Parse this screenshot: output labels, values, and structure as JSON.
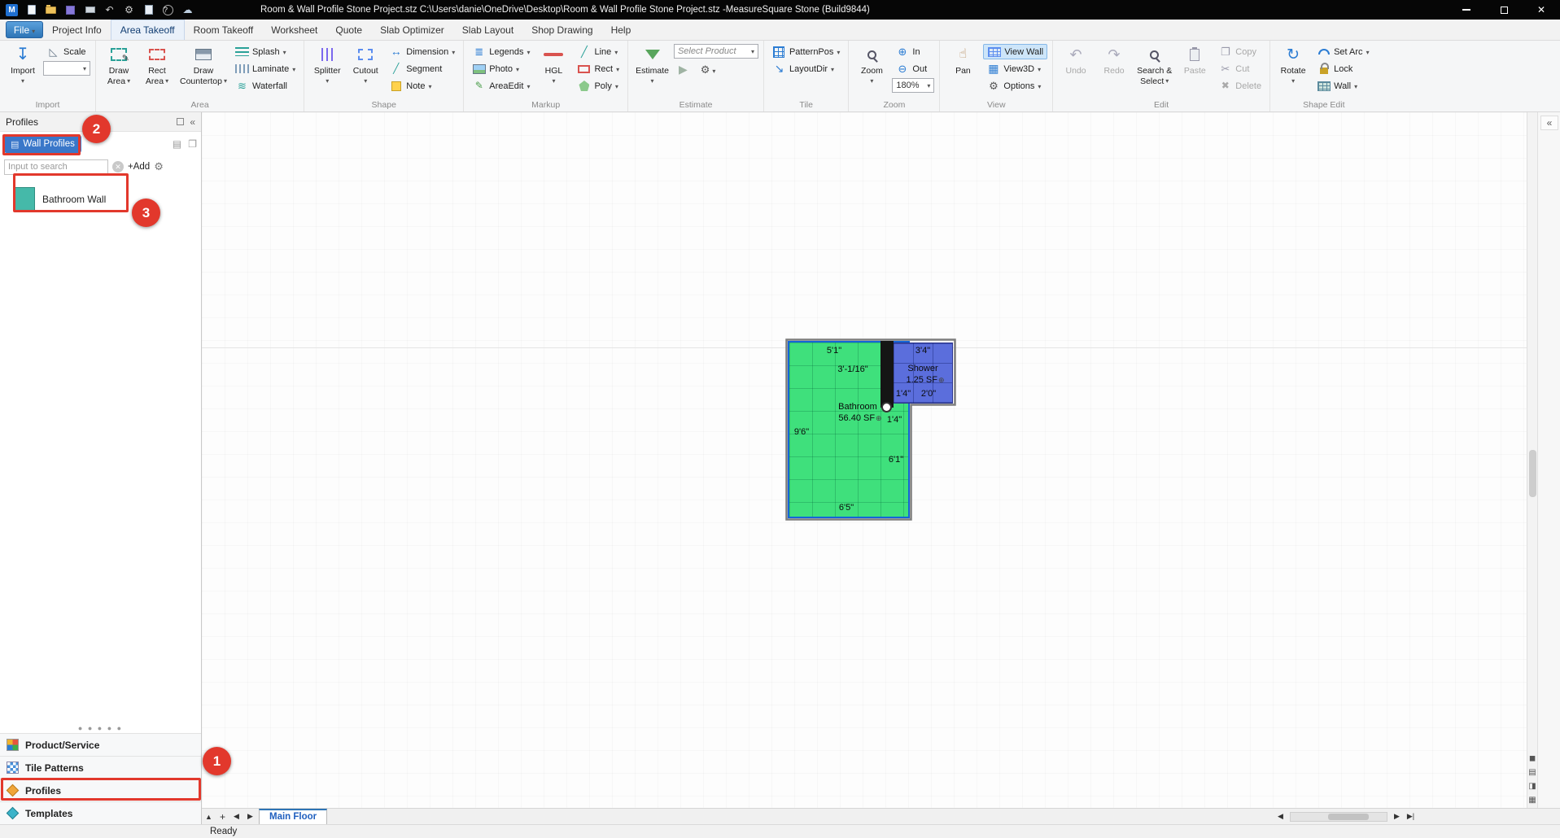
{
  "titlebar": {
    "app_initial": "M",
    "title": "Room & Wall Profile Stone Project.stz C:\\Users\\danie\\OneDrive\\Desktop\\Room & Wall Profile Stone Project.stz -MeasureSquare Stone (Build9844)"
  },
  "menu": {
    "file": "File",
    "tabs": [
      "Project Info",
      "Area Takeoff",
      "Room Takeoff",
      "Worksheet",
      "Quote",
      "Slab Optimizer",
      "Slab Layout",
      "Shop Drawing",
      "Help"
    ],
    "active_tab": "Area Takeoff"
  },
  "ribbon": {
    "groups": {
      "import": "Import",
      "area": "Area",
      "shape": "Shape",
      "markup": "Markup",
      "estimate": "Estimate",
      "tile": "Tile",
      "zoom": "Zoom",
      "view": "View",
      "edit": "Edit",
      "shape_edit": "Shape Edit"
    },
    "import_btn": "Import",
    "scale": "Scale",
    "draw_area": [
      "Draw",
      "Area"
    ],
    "rect_area": [
      "Rect",
      "Area"
    ],
    "draw_countertop": [
      "Draw",
      "Countertop"
    ],
    "splash": "Splash",
    "laminate": "Laminate",
    "waterfall": "Waterfall",
    "splitter": "Splitter",
    "cutout": "Cutout",
    "dimension": "Dimension",
    "segment": "Segment",
    "note": "Note",
    "legends": "Legends",
    "photo": "Photo",
    "areaedit": "AreaEdit",
    "hgl": "HGL",
    "line": "Line",
    "rect": "Rect",
    "poly": "Poly",
    "estimate_btn": "Estimate",
    "select_product": "Select Product",
    "patternpos": "PatternPos",
    "layoutdir": "LayoutDir",
    "zoom_btn": "Zoom",
    "zoom_in": "In",
    "zoom_out": "Out",
    "zoom_level": "180%",
    "pan": "Pan",
    "view_wall": "View Wall",
    "view3d": "View3D",
    "options": "Options",
    "undo": "Undo",
    "redo": "Redo",
    "search_select": [
      "Search &",
      "Select"
    ],
    "paste": "Paste",
    "copy": "Copy",
    "cut": "Cut",
    "delete": "Delete",
    "rotate": "Rotate",
    "set_arc": "Set Arc",
    "lock": "Lock",
    "wall": "Wall"
  },
  "sidebar": {
    "header": "Profiles",
    "profile_selector": "Wall Profiles",
    "search_placeholder": "Input to search",
    "add_btn": "+Add",
    "items": [
      {
        "name": "Bathroom Wall",
        "swatch": "#45b9a9"
      }
    ],
    "nav": [
      {
        "label": "Product/Service"
      },
      {
        "label": "Tile Patterns"
      },
      {
        "label": "Profiles"
      },
      {
        "label": "Templates"
      }
    ]
  },
  "drawing": {
    "bathroom": {
      "name": "Bathroom",
      "area": "56.40 SF",
      "fill": "#3fe07c",
      "dim_top": "5'1\"",
      "dim_top_inner": "3'-1/16\"",
      "dim_left": "9'6\"",
      "dim_right": "6'1\"",
      "dim_bottom": "6'5\""
    },
    "shower": {
      "name": "Shower",
      "area": "1.25 SF",
      "fill": "#5b6edc",
      "dim_top": "3'4\"",
      "dim_bottom_left": "1'4\"",
      "dim_bottom_right": "2'0\"",
      "dim_wall": "1'4\""
    }
  },
  "annotations": {
    "step1": "1",
    "step2": "2",
    "step3": "3",
    "color": "#e2382c"
  },
  "sheet": {
    "tab": "Main Floor"
  },
  "status": {
    "text": "Ready"
  },
  "colors": {
    "accent": "#2e75b6",
    "annotation": "#e2382c"
  }
}
